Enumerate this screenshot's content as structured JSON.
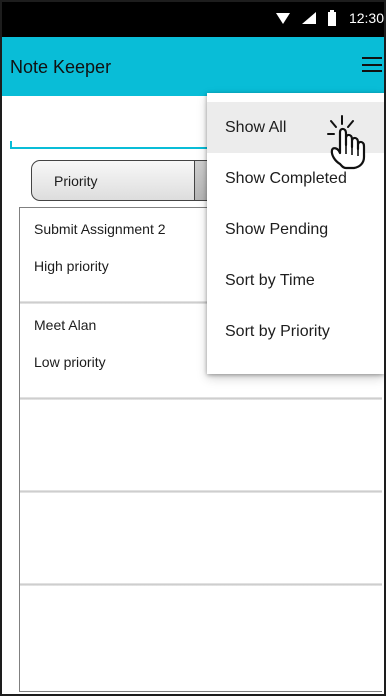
{
  "status_bar": {
    "time": "12:30",
    "icons": [
      "wifi-icon",
      "signal-icon",
      "battery-icon"
    ]
  },
  "app_bar": {
    "title": "Note Keeper",
    "menu_icon": "hamburger-menu-icon",
    "color": "#09bdd7"
  },
  "sort_toggle": {
    "selected_label": "Priority"
  },
  "notes": [
    {
      "title": "Submit Assignment 2",
      "priority": "High priority"
    },
    {
      "title": "Meet Alan",
      "priority": "Low priority"
    }
  ],
  "empty_rows": 3,
  "menu": {
    "items": [
      {
        "label": "Show All",
        "active": true
      },
      {
        "label": "Show Completed",
        "active": false
      },
      {
        "label": "Show Pending",
        "active": false
      },
      {
        "label": "Sort by Time",
        "active": false
      },
      {
        "label": "Sort by Priority",
        "active": false
      }
    ],
    "cursor_icon": "hand-pointer-icon"
  },
  "colors": {
    "accent": "#09bdd7",
    "status_bar": "#000000",
    "menu_highlight": "#ececec"
  }
}
